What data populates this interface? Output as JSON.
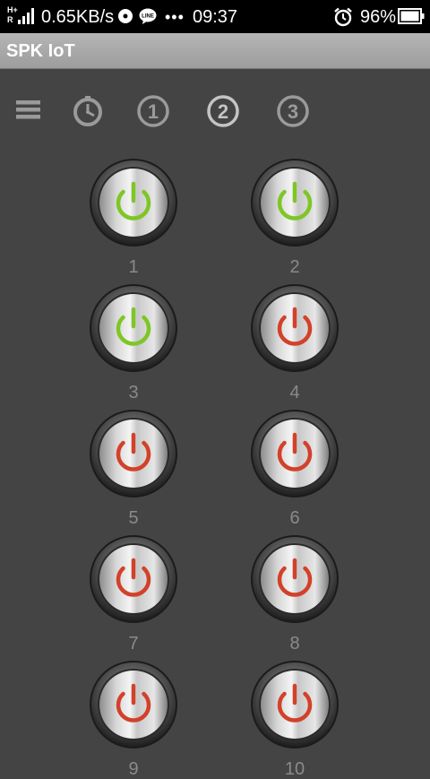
{
  "status_bar": {
    "network_type_top": "H+",
    "network_type_bottom": "R",
    "speed": "0.65KB/s",
    "notification_more": "•••",
    "time": "09:37",
    "battery": "96%",
    "icons": [
      "signal-icon",
      "sync-disc-icon",
      "line-app-icon",
      "alarm-icon",
      "battery-icon"
    ]
  },
  "app_bar": {
    "title": "SPK IoT"
  },
  "toolbar": {
    "items": [
      {
        "icon": "menu-icon"
      },
      {
        "icon": "timer-icon"
      },
      {
        "icon": "tab-1-icon",
        "label": "1"
      },
      {
        "icon": "tab-2-icon",
        "label": "2",
        "selected": true
      },
      {
        "icon": "tab-3-icon",
        "label": "3"
      }
    ]
  },
  "switches": [
    {
      "label": "1",
      "state": "on"
    },
    {
      "label": "2",
      "state": "on"
    },
    {
      "label": "3",
      "state": "on"
    },
    {
      "label": "4",
      "state": "off"
    },
    {
      "label": "5",
      "state": "off"
    },
    {
      "label": "6",
      "state": "off"
    },
    {
      "label": "7",
      "state": "off"
    },
    {
      "label": "8",
      "state": "off"
    },
    {
      "label": "9",
      "state": "off"
    },
    {
      "label": "10",
      "state": "off"
    }
  ],
  "colors": {
    "on": "#7ec626",
    "off": "#d2412a",
    "background": "#444444",
    "label": "#8a8a8a",
    "toolbar_icon": "#9a9a9a",
    "toolbar_icon_selected": "#c4c4c4"
  }
}
